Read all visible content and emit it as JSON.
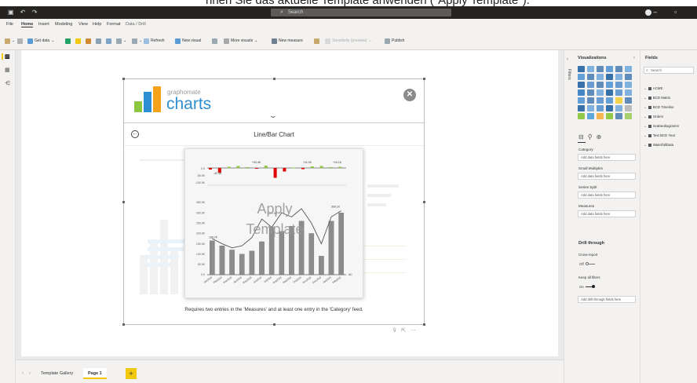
{
  "caption_text": "nnen Sie das aktuelle Template anwenden (\"Apply Template\").",
  "titlebar": {
    "search_placeholder": "Search"
  },
  "menu": [
    "File",
    "Home",
    "Insert",
    "Modeling",
    "View",
    "Help",
    "Format",
    "Data / Drill"
  ],
  "menu_active": "Home",
  "ribbon": {
    "get_data": "Get data",
    "refresh": "Refresh",
    "new_visual": "New visual",
    "more_visuals": "More visuals",
    "new_measure": "New measure",
    "sensitivity": "Sensitivity (preview)",
    "publish": "Publish"
  },
  "visual": {
    "brand_small": "graphomate",
    "brand_big": "charts",
    "close_symbol": "✕",
    "chevron_symbol": "⌄",
    "title": "Line/Bar Chart",
    "apply_line1": "Apply",
    "apply_line2": "Template",
    "requires_text": "Requires two entries in the 'Measures' and at least one entry in the 'Category' feed."
  },
  "preview_chart": {
    "delta_bars": [
      -0.4,
      -1.2,
      0.3,
      0.5,
      0.2,
      -0.2,
      0.6,
      -2.5,
      -0.9,
      0.1,
      -0.3,
      0.4,
      0.5,
      0.2,
      0.3
    ],
    "delta_colors": [
      "#e00000",
      "#e00000",
      "#8dc63f",
      "#8dc63f",
      "#8dc63f",
      "#e00000",
      "#8dc63f",
      "#e00000",
      "#e00000",
      "#8dc63f",
      "#e00000",
      "#8dc63f",
      "#8dc63f",
      "#8dc63f",
      "#8dc63f"
    ],
    "delta_labels": [
      "-42.3K",
      "+33.4K",
      "+11.0K",
      "+10.1K"
    ],
    "delta_tick_labels": [
      "0.0",
      "-50.0K",
      "-100.0K"
    ],
    "bars": [
      165,
      140,
      120,
      100,
      115,
      160,
      230,
      210,
      235,
      260,
      200,
      90,
      260,
      300
    ],
    "line": [
      175,
      150,
      130,
      140,
      180,
      270,
      230,
      300,
      280,
      320,
      250,
      150,
      280,
      310
    ],
    "bar_labels": [
      "190.7K",
      "277.4K",
      "300.1K"
    ],
    "y_ticks": [
      "350.0K",
      "300.0K",
      "250.0K",
      "200.0K",
      "150.0K",
      "100.0K",
      "50.0K",
      "0.0"
    ],
    "x_labels": [
      "Jan2018",
      "Feb2018",
      "Mar2018",
      "Apr2018",
      "May2018",
      "Jun2018",
      "Jul2018",
      "Aug2018",
      "Sep2018",
      "Oct2018",
      "Nov2018",
      "Dec2018",
      "Jan2019",
      "Feb2019"
    ],
    "end_label": "AC"
  },
  "pages": {
    "tabs": [
      "Template Gallery",
      "Page 1"
    ],
    "active": "Page 1",
    "add_symbol": "+"
  },
  "visualizations": {
    "title": "Visualizations",
    "filters_label": "Filters",
    "wells": [
      {
        "label": "Category",
        "placeholder": "Add data fields here"
      },
      {
        "label": "Small Multiples",
        "placeholder": "Add data fields here"
      },
      {
        "label": "Series Split",
        "placeholder": "Add data fields here"
      },
      {
        "label": "Measures",
        "placeholder": "Add data fields here"
      }
    ],
    "drill_title": "Drill through",
    "cross_report_label": "Cross-report",
    "cross_report_state": "Off",
    "keep_filters_label": "Keep all filters",
    "keep_filters_state": "On",
    "drill_placeholder": "Add drill-through fields here"
  },
  "fields": {
    "title": "Fields",
    "search_placeholder": "Search",
    "tables": [
      "ACME",
      "BCD Matrix",
      "BCD Timeline",
      "Orders",
      "Scatterdiagramm",
      "Text BCD Year",
      "WaterfallData"
    ]
  }
}
